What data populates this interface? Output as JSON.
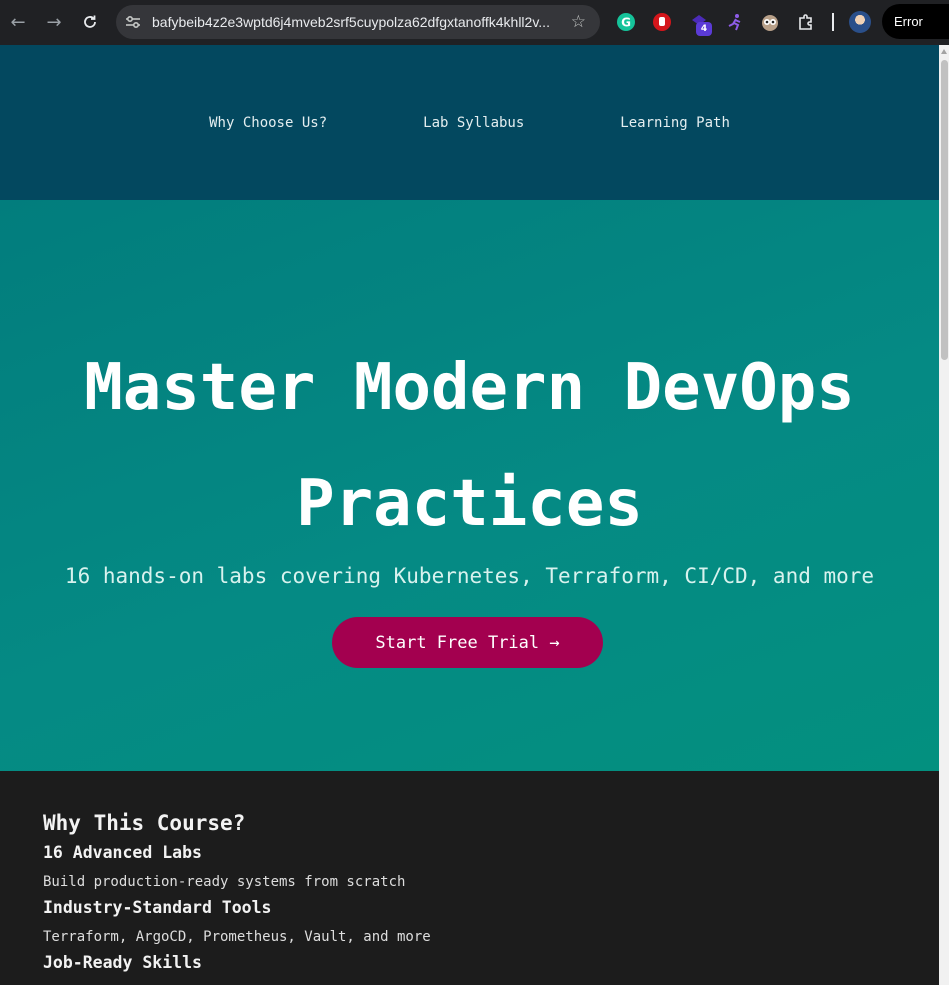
{
  "browser": {
    "url": "bafybeib4z2e3wptd6j4mveb2srf5cuypolza62dfgxtanoffk4khll2v...",
    "extension_badge": "4",
    "error_label": "Error"
  },
  "nav": {
    "items": [
      "Why Choose Us?",
      "Lab Syllabus",
      "Learning Path"
    ]
  },
  "hero": {
    "title": "Master Modern DevOps Practices",
    "subtitle": "16 hands-on labs covering Kubernetes, Terraform, CI/CD, and more",
    "cta_label": "Start Free Trial →"
  },
  "features": {
    "heading": "Why This Course?",
    "items": [
      {
        "title": "16 Advanced Labs",
        "desc": "Build production-ready systems from scratch"
      },
      {
        "title": "Industry-Standard Tools",
        "desc": "Terraform, ArgoCD, Prometheus, Vault, and more"
      },
      {
        "title": "Job-Ready Skills",
        "desc": ""
      }
    ]
  },
  "colors": {
    "nav_bg": "#03485f",
    "hero_bg": "#058a84",
    "cta_bg": "#a3004f",
    "features_bg": "#1c1c1c"
  }
}
